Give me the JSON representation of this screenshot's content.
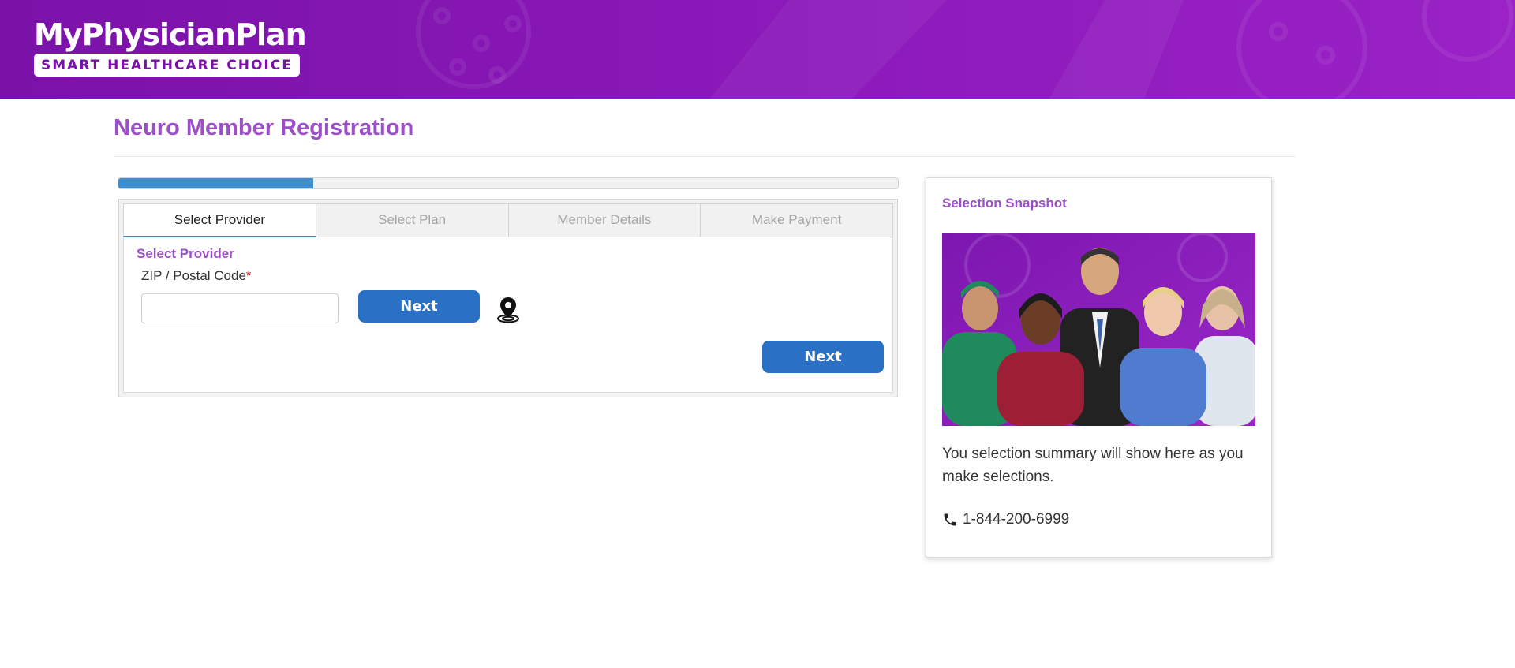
{
  "header": {
    "logo_title": "MyPhysicianPlan",
    "logo_tagline": "SMART HEALTHCARE CHOICE",
    "background_color": "#8a18b8"
  },
  "page": {
    "title": "Neuro Member Registration"
  },
  "progress": {
    "fraction": 0.25,
    "color": "#3f8fd0"
  },
  "wizard": {
    "tabs": [
      {
        "label": "Select Provider",
        "active": true
      },
      {
        "label": "Select Plan",
        "active": false
      },
      {
        "label": "Member Details",
        "active": false
      },
      {
        "label": "Make Payment",
        "active": false
      }
    ],
    "section_label": "Select Provider",
    "zip_field": {
      "label": "ZIP / Postal Code",
      "required_marker": "*",
      "value": "",
      "placeholder": ""
    },
    "zip_next_label": "Next",
    "geo_icon": "map-pin-location-icon",
    "next_label": "Next"
  },
  "snapshot": {
    "title": "Selection Snapshot",
    "image": "healthcare-workers-group-photo",
    "summary_text": "You selection summary will show here as you make selections.",
    "phone_icon": "phone-icon",
    "phone": "1-844-200-6999"
  },
  "colors": {
    "accent_purple": "#9b4fc9",
    "button_blue": "#2a71c6",
    "required_red": "#d9232e"
  }
}
